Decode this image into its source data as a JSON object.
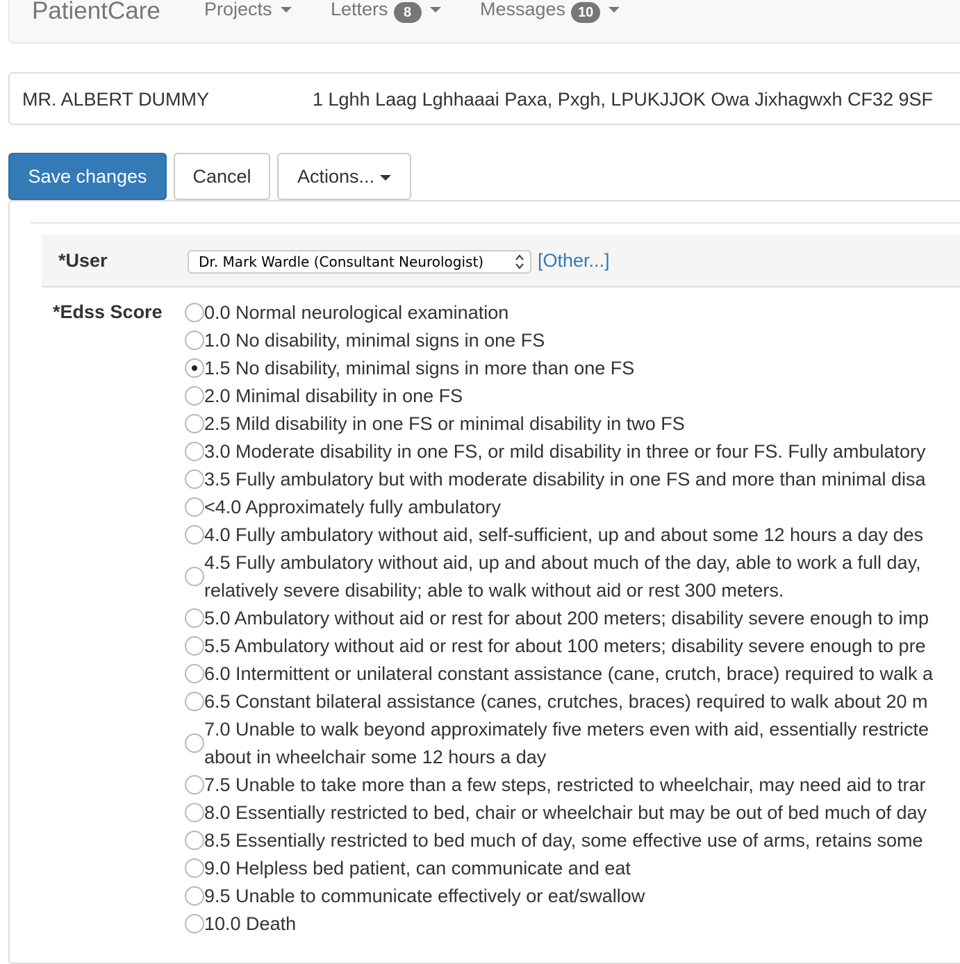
{
  "navbar": {
    "brand": "PatientCare",
    "items": [
      {
        "label": "Projects",
        "badge": ""
      },
      {
        "label": "Letters",
        "badge": "8"
      },
      {
        "label": "Messages",
        "badge": "10"
      }
    ]
  },
  "patient": {
    "name": "MR. ALBERT DUMMY",
    "address": "1 Lghh Laag Lghhaaai Paxa, Pxgh, LPUKJJOK Owa Jixhagwxh CF32 9SF"
  },
  "toolbar": {
    "save_label": "Save changes",
    "cancel_label": "Cancel",
    "actions_label": "Actions..."
  },
  "form": {
    "user_label": "*User",
    "user_selected": "Dr. Mark Wardle (Consultant Neurologist)",
    "other_link": "[Other...]",
    "edss_label": "*Edss Score",
    "edss_options": [
      "0.0 Normal neurological examination",
      "1.0 No disability, minimal signs in one FS",
      "1.5 No disability, minimal signs in more than one FS",
      "2.0 Minimal disability in one FS",
      "2.5 Mild disability in one FS or minimal disability in two FS",
      "3.0 Moderate disability in one FS, or mild disability in three or four FS. Fully ambulatory",
      "3.5 Fully ambulatory but with moderate disability in one FS and more than minimal disa",
      "<4.0 Approximately fully ambulatory",
      "4.0 Fully ambulatory without aid, self-sufficient, up and about some 12 hours a day des",
      "4.5 Fully ambulatory without aid, up and about much of the day, able to work a full day, relatively severe disability; able to walk without aid or rest 300 meters.",
      "5.0 Ambulatory without aid or rest for about 200 meters; disability severe enough to imp",
      "5.5 Ambulatory without aid or rest for about 100 meters; disability severe enough to pre",
      "6.0 Intermittent or unilateral constant assistance (cane, crutch, brace) required to walk a",
      "6.5 Constant bilateral assistance (canes, crutches, braces) required to walk about 20 m",
      "7.0 Unable to walk beyond approximately five meters even with aid, essentially restricte about in wheelchair some 12 hours a day",
      "7.5 Unable to take more than a few steps, restricted to wheelchair, may need aid to trar",
      "8.0 Essentially restricted to bed, chair or wheelchair but may be out of bed much of day",
      "8.5 Essentially restricted to bed much of day, some effective use of arms, retains some",
      "9.0 Helpless bed patient, can communicate and eat",
      "9.5 Unable to communicate effectively or eat/swallow",
      "10.0 Death"
    ],
    "edss_selected": "1.5 No disability, minimal signs in more than one FS"
  }
}
